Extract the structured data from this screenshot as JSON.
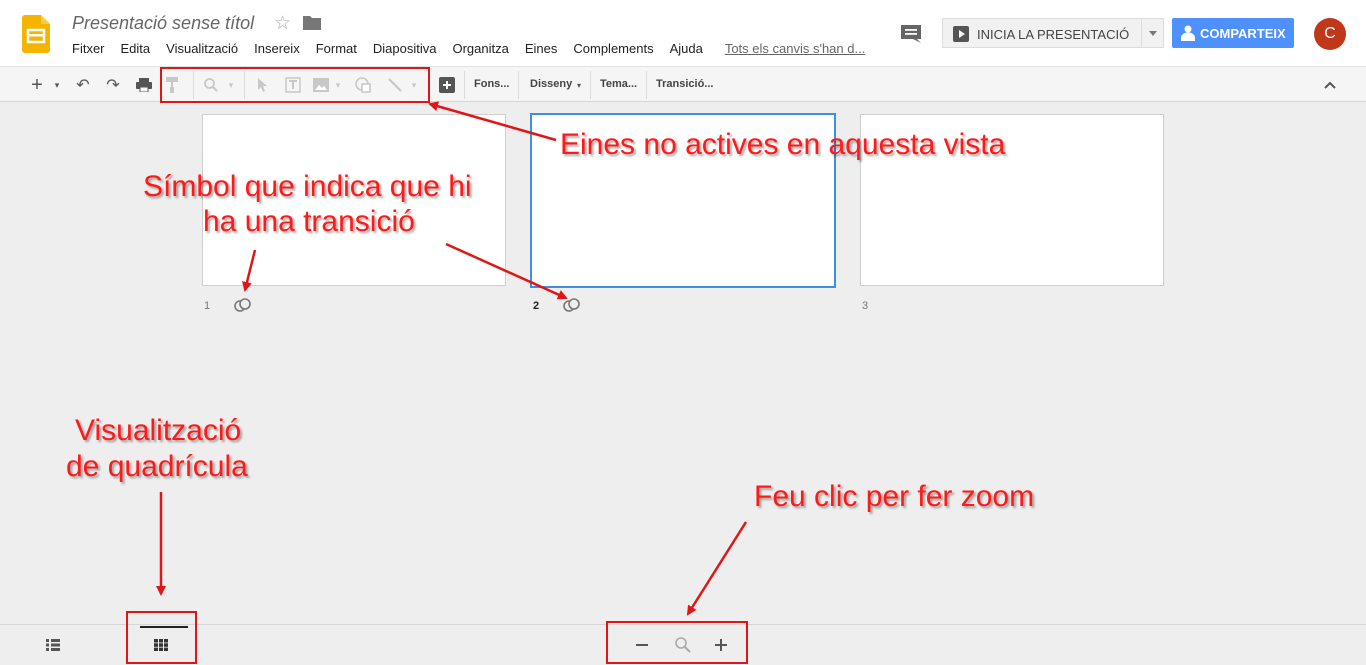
{
  "app": {
    "title": "Presentació sense títol",
    "menus": [
      "Fitxer",
      "Edita",
      "Visualització",
      "Insereix",
      "Format",
      "Diapositiva",
      "Organitza",
      "Eines",
      "Complements",
      "Ajuda"
    ],
    "saved_status": "Tots els canvis s'han d...",
    "present_label": "INICIA LA PRESENTACIÓ",
    "share_label": "COMPARTEIX",
    "avatar_initial": "C"
  },
  "toolbar": {
    "background_label": "Fons...",
    "layout_label": "Disseny",
    "theme_label": "Tema...",
    "transition_label": "Transició..."
  },
  "slides": [
    {
      "number": "1",
      "selected": false,
      "has_transition": true
    },
    {
      "number": "2",
      "selected": true,
      "has_transition": true
    },
    {
      "number": "3",
      "selected": false,
      "has_transition": false
    }
  ],
  "annotations": {
    "inactive_tools": "Eines no actives en aquesta vista",
    "transition_symbol_line1": "Símbol que indica que hi",
    "transition_symbol_line2": "ha una transició",
    "grid_view_line1": "Visualització",
    "grid_view_line2": "de quadrícula",
    "zoom": "Feu clic per fer zoom"
  },
  "colors": {
    "accent_blue": "#4d90fe",
    "selection_blue": "#3d8fe0",
    "annotation_red": "#ff1a1a",
    "avatar": "#c1371a",
    "logo_yellow": "#f4b400"
  }
}
